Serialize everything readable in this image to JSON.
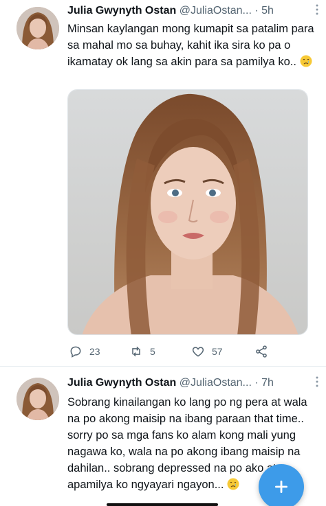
{
  "tweets": [
    {
      "display_name": "Julia Gwynyth Ostan",
      "handle": "@JuliaOstan...",
      "separator": "·",
      "time": "5h",
      "more_icon": "more-vertical-icon",
      "text": "Minsan kaylangan mong kumapit sa patalim para sa mahal mo sa buhay, kahit ika sira ko pa o ikamatay ok lang sa akin para sa pamilya ko..",
      "emoji": "crying-face-emoji",
      "has_media": true,
      "stats": {
        "replies": "23",
        "retweets": "5",
        "likes": "57"
      }
    },
    {
      "display_name": "Julia Gwynyth Ostan",
      "handle": "@JuliaOstan...",
      "separator": "·",
      "time": "7h",
      "more_icon": "more-vertical-icon",
      "text": "Sobrang kinailangan ko lang po ng pera at wala na po akong maisip na ibang paraan that time.. sorry po sa mga fans ko alam kong mali yung nagawa ko, wala na po akong ibang maisip na dahilan.. sobrang depressed na po ako at apamilya ko ngyayari ngayon...",
      "emoji": "crying-face-emoji"
    }
  ],
  "fab": {
    "icon": "plus-icon",
    "color": "#3d9be9"
  },
  "colors": {
    "text": "#0f1419",
    "secondary": "#536471",
    "accent": "#3d9be9"
  }
}
